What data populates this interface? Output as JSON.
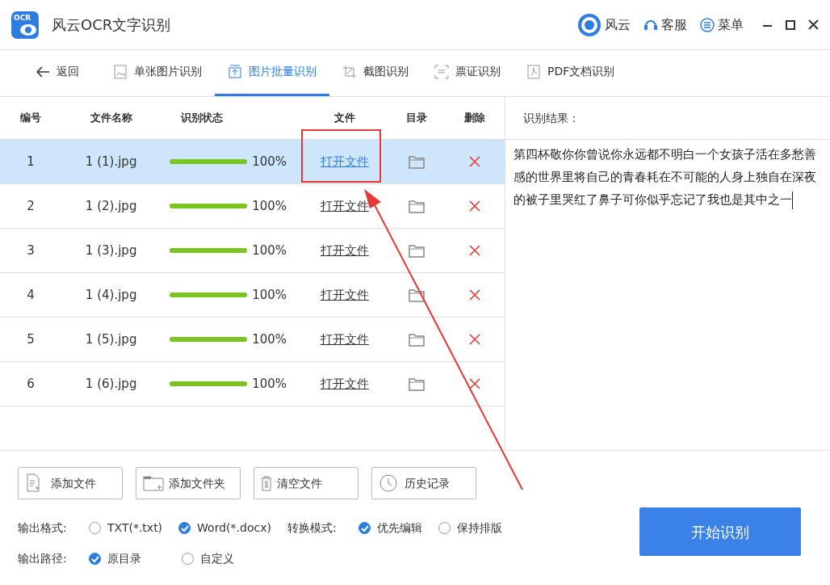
{
  "window": {
    "title": "风云OCR文字识别",
    "logo_text": "OCR",
    "links": [
      "风云",
      "客服",
      "菜单"
    ]
  },
  "tabs": [
    {
      "label": "返回",
      "kind": "back",
      "selected": false
    },
    {
      "label": "单张图片识别",
      "kind": "image",
      "selected": false
    },
    {
      "label": "图片批量识别",
      "kind": "upload",
      "selected": true
    },
    {
      "label": "截图识别",
      "kind": "crop",
      "selected": false
    },
    {
      "label": "票证识别",
      "kind": "scan",
      "selected": false
    },
    {
      "label": "PDF文档识别",
      "kind": "pdf",
      "selected": false
    }
  ],
  "table": {
    "columns": [
      "编号",
      "文件名称",
      "识别状态",
      "文件",
      "目录",
      "删除"
    ],
    "rows": [
      {
        "number": "1",
        "name": "1 (1).jpg",
        "level": 1,
        "percent": "100%",
        "link": "打开文件",
        "selected": true
      },
      {
        "number": "2",
        "name": "1 (2).jpg",
        "level": 1,
        "percent": "100%",
        "link": "打开文件",
        "selected": false
      },
      {
        "number": "3",
        "name": "1 (3).jpg",
        "level": 1,
        "percent": "100%",
        "link": "打开文件",
        "selected": false
      },
      {
        "number": "4",
        "name": "1 (4).jpg",
        "level": 1,
        "percent": "100%",
        "link": "打开文件",
        "selected": false
      },
      {
        "number": "5",
        "name": "1 (5).jpg",
        "level": 1,
        "percent": "100%",
        "link": "打开文件",
        "selected": false
      },
      {
        "number": "6",
        "name": "1 (6).jpg",
        "level": 1,
        "percent": "100%",
        "link": "打开文件",
        "selected": false
      }
    ]
  },
  "result": {
    "label": "识别结果：",
    "text": "第四杯敬你你曾说你永远都不明白一个女孩子活在多愁善感的世界里将自己的青春耗在不可能的人身上独自在深夜的被子里哭红了鼻子可你似乎忘记了我也是其中之一"
  },
  "actions": [
    {
      "label": "添加文件",
      "kind": "file"
    },
    {
      "label": "添加文件夹",
      "kind": "folder"
    },
    {
      "label": "清空文件",
      "kind": "trash"
    },
    {
      "label": "历史记录",
      "kind": "clock"
    }
  ],
  "options": [
    {
      "label": "输出格式:",
      "choices": [
        {
          "label": "TXT(*.txt)",
          "selected": false
        },
        {
          "label": "Word(*.docx)",
          "selected": true
        }
      ]
    },
    {
      "label": "转换模式:",
      "choices": [
        {
          "label": "优先编辑",
          "selected": true
        },
        {
          "label": "保持排版",
          "selected": false
        }
      ]
    },
    {
      "label": "输出路径:",
      "choices": [
        {
          "label": "原目录",
          "selected": true
        },
        {
          "label": "自定义",
          "selected": false
        }
      ]
    }
  ],
  "start_button": "开始识别"
}
